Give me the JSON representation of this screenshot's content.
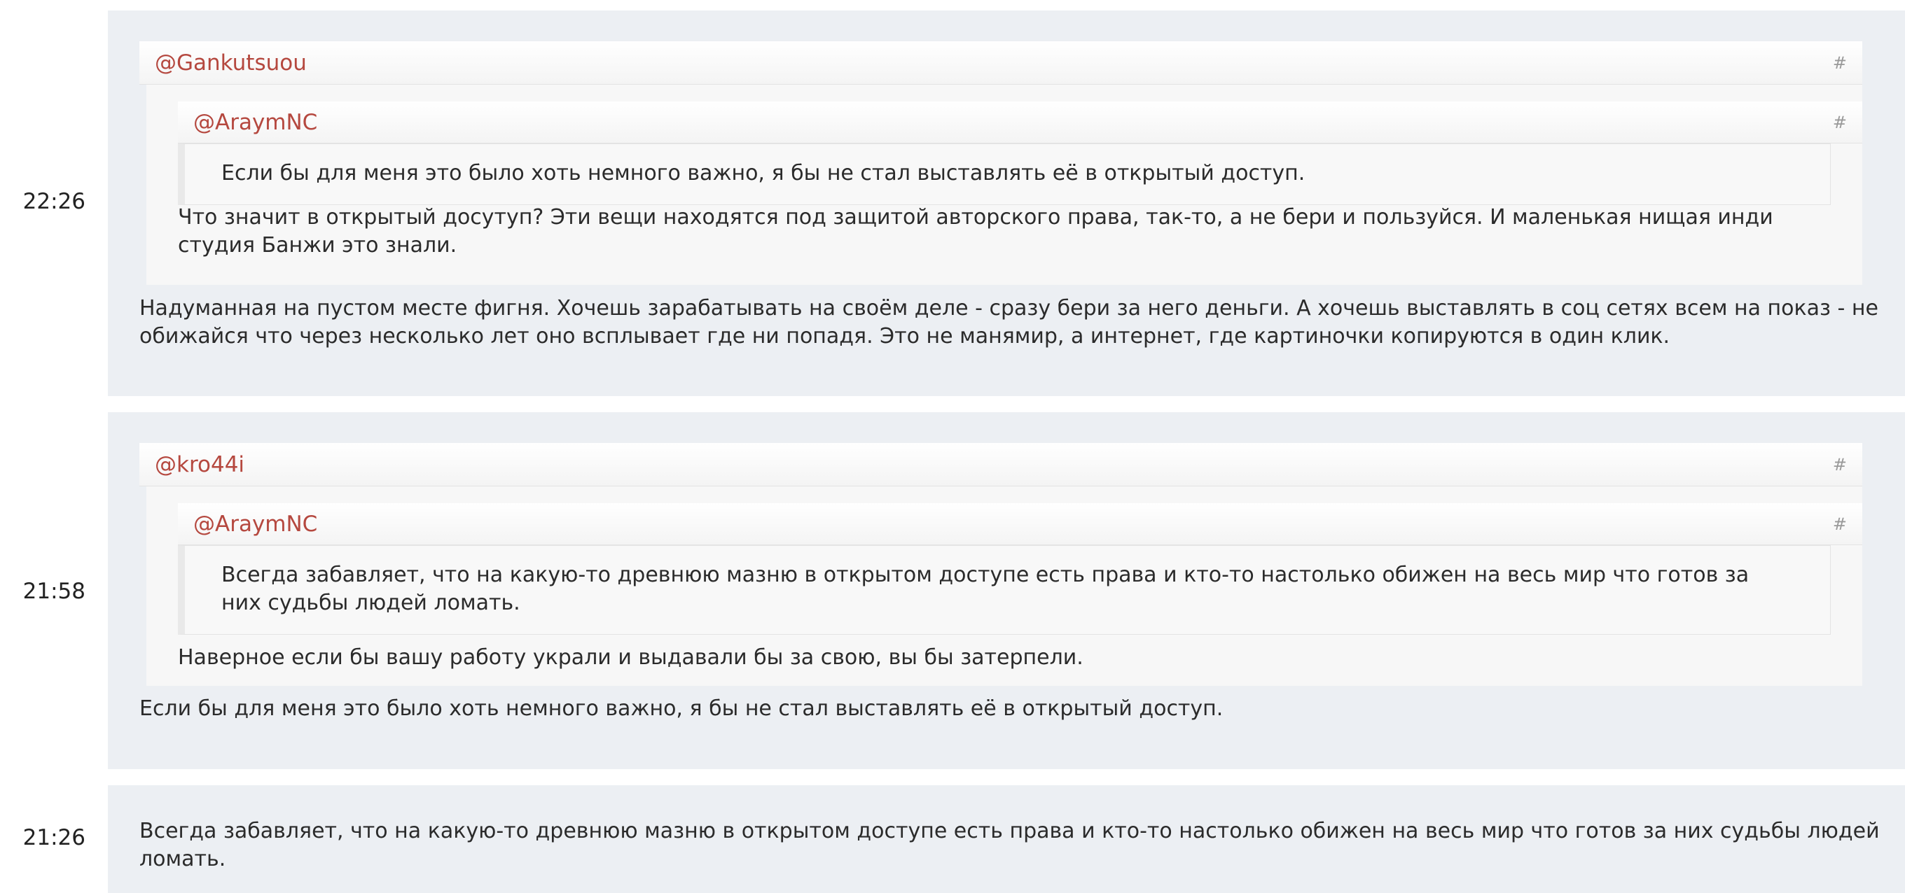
{
  "comments": [
    {
      "time": "22:26",
      "quote": {
        "author": "@Gankutsuou",
        "hash": "#",
        "inner": {
          "author": "@AraymNC",
          "hash": "#",
          "text": "Если бы для меня это было хоть немного важно, я бы не стал выставлять её в открытый доступ."
        },
        "text": "Что значит в открытый досутуп? Эти вещи находятся под защитой авторского права, так-то, а не бери и пользуйся. И маленькая нищая инди студия Банжи это знали."
      },
      "text": "Надуманная на пустом месте фигня. Хочешь зарабатывать на своём деле - сразу бери за него деньги. А хочешь выставлять в соц сетях всем на показ - не обижайся что через несколько лет оно всплывает где ни попадя. Это не манямир, а интернет, где картиночки копируются в один клик."
    },
    {
      "time": "21:58",
      "quote": {
        "author": "@kro44i",
        "hash": "#",
        "inner": {
          "author": "@AraymNC",
          "hash": "#",
          "text": "Всегда забавляет, что на какую-то древнюю мазню в открытом доступе есть права и кто-то настолько обижен на весь мир что готов за них судьбы людей ломать."
        },
        "text": "Наверное если бы вашу работу украли и выдавали бы за свою, вы бы затерпели."
      },
      "text": "Если бы для меня это было хоть немного важно, я бы не стал выставлять её в открытый доступ."
    },
    {
      "time": "21:26",
      "text": "Всегда забавляет, что на какую-то древнюю мазню в открытом доступе есть права и кто-то настолько обижен на весь мир что готов за них судьбы людей ломать."
    }
  ]
}
